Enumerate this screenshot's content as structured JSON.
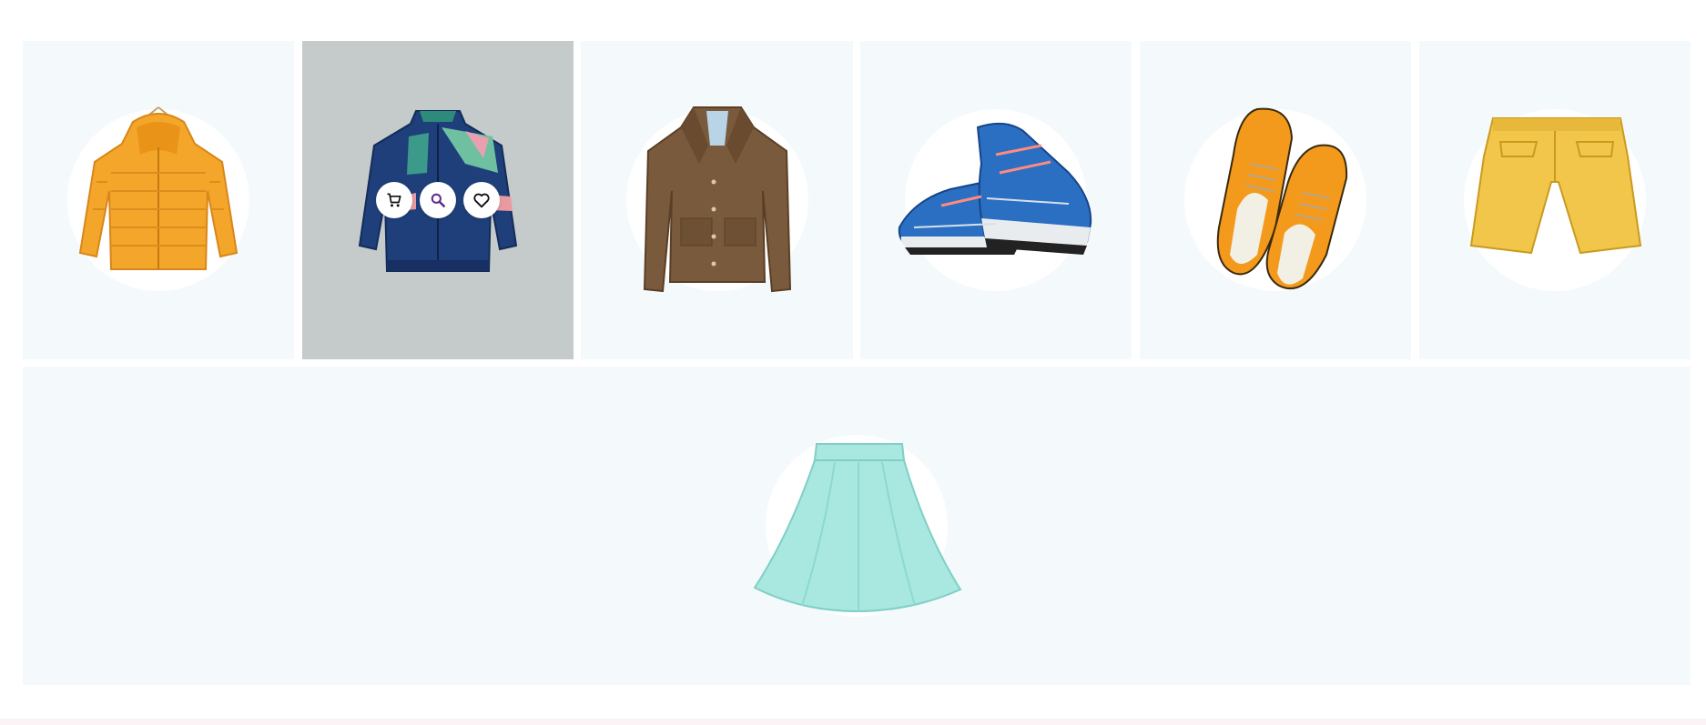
{
  "products": [
    {
      "icon": "puffer-jacket-icon",
      "color": "#f3a62a"
    },
    {
      "icon": "windbreaker-jacket-icon",
      "color": "#1e3f7a"
    },
    {
      "icon": "trench-jacket-icon",
      "color": "#7a5a3c"
    },
    {
      "icon": "sneakers-icon",
      "color": "#2a6fc2"
    },
    {
      "icon": "oxford-shoes-icon",
      "color": "#f39a1c"
    },
    {
      "icon": "shorts-icon",
      "color": "#f2c64a"
    },
    {
      "icon": "skirt-icon",
      "color": "#a8e8e0"
    }
  ],
  "hover_actions": [
    {
      "icon": "cart-icon"
    },
    {
      "icon": "search-icon",
      "color": "#5a2a8a"
    },
    {
      "icon": "heart-icon"
    }
  ],
  "colors": {
    "card_bg": "#f4f9fb",
    "hover_bg": "#c5cacb",
    "footer_strip": "#fbf3f5"
  }
}
